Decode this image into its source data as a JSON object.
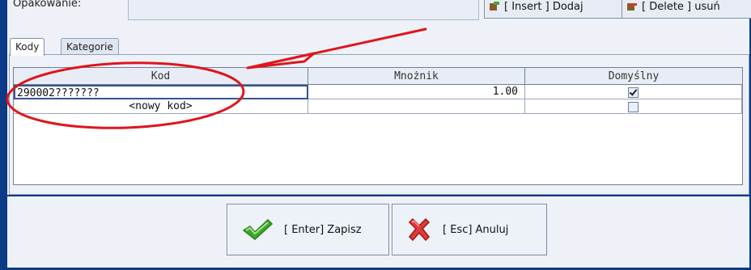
{
  "top": {
    "field_label": "Opakowanie:",
    "insert_button": "[ Insert ] Dodaj",
    "delete_button": "[ Delete ] usuń"
  },
  "tabs": [
    {
      "label": "Kody",
      "active": true
    },
    {
      "label": "Kategorie",
      "active": false
    }
  ],
  "table": {
    "columns": [
      "Kod",
      "Mnożnik",
      "Domyślny"
    ],
    "rows": [
      {
        "kod": "290002???????",
        "mnoznik": "1.00",
        "domyslny": true
      },
      {
        "kod": "<nowy kod>",
        "mnoznik": "",
        "domyslny": false
      }
    ]
  },
  "footer": {
    "save_label": "[ Enter] Zapisz",
    "cancel_label": "[ Esc] Anuluj"
  },
  "colors": {
    "frame_blue": "#0b3b86",
    "annotation_red": "#e0151b",
    "check_green": "#3ea82a",
    "cancel_red": "#e23a3a"
  }
}
